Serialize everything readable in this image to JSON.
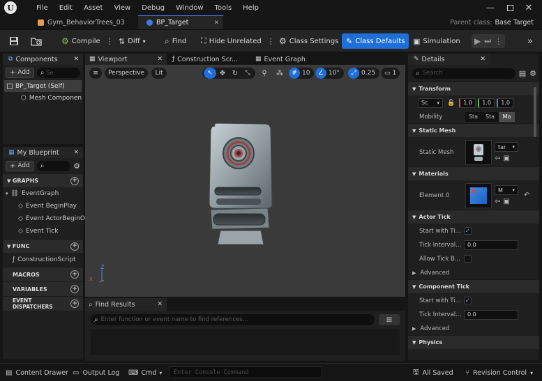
{
  "menu": [
    "File",
    "Edit",
    "Asset",
    "View",
    "Debug",
    "Window",
    "Tools",
    "Help"
  ],
  "doc_tabs": [
    {
      "label": "Gym_BehaviorTrees_03",
      "active": false
    },
    {
      "label": "BP_Target",
      "active": true
    }
  ],
  "parent_class": {
    "label": "Parent class:",
    "value": "Base Target"
  },
  "toolbar": {
    "compile": "Compile",
    "diff": "Diff",
    "find": "Find",
    "hide_unrelated": "Hide Unrelated",
    "class_settings": "Class Settings",
    "class_defaults": "Class Defaults",
    "simulation": "Simulation"
  },
  "components": {
    "tab": "Components",
    "add": "Add",
    "search_placeholder": "Se",
    "items": [
      "BP_Target (Self)",
      "Mesh Componen"
    ]
  },
  "blueprint": {
    "tab": "My Blueprint",
    "add": "Add",
    "graphs_header": "GRAPHS",
    "graph": "EventGraph",
    "events": [
      "Event BeginPlay",
      "Event ActorBeginO",
      "Event Tick"
    ],
    "func_header": "FUNC",
    "func_item": "ConstructionScript",
    "macros": "MACROS",
    "variables": "VARIABLES",
    "dispatchers": "EVENT DISPATCHERS"
  },
  "editor_tabs": [
    "Viewport",
    "Construction Scr...",
    "Event Graph"
  ],
  "viewport": {
    "perspective": "Perspective",
    "lit": "Lit",
    "grid_value": "10",
    "rot_value": "10°",
    "scale_value": "0.25",
    "cam_value": "1",
    "axis_z": "Z",
    "axis_x": "X"
  },
  "find_results": {
    "tab": "Find Results",
    "placeholder": "Enter function or event name to find references..."
  },
  "details": {
    "tab": "Details",
    "search_placeholder": "Search",
    "transform": {
      "header": "Transform",
      "dropdown": "Sc",
      "x": "1.0",
      "y": "1.0",
      "z": "1.0",
      "mobility_label": "Mobility",
      "mobility_options": [
        "Sta",
        "Sta",
        "Mo"
      ]
    },
    "static_mesh": {
      "header": "Static Mesh",
      "label": "Static Mesh",
      "value": "tar"
    },
    "materials": {
      "header": "Materials",
      "label": "Element 0",
      "value": "M"
    },
    "actor_tick": {
      "header": "Actor Tick",
      "start_label": "Start with Ti...",
      "interval_label": "Tick Interval...",
      "interval_value": "0.0",
      "allow_label": "Allow Tick B...",
      "advanced": "Advanced"
    },
    "component_tick": {
      "header": "Component Tick",
      "start_label": "Start with Ti...",
      "interval_label": "Tick Interval...",
      "interval_value": "0.0",
      "advanced": "Advanced"
    },
    "physics": {
      "header": "Physics"
    }
  },
  "statusbar": {
    "content_drawer": "Content Drawer",
    "output_log": "Output Log",
    "cmd": "Cmd",
    "console_placeholder": "Enter Console Command",
    "all_saved": "All Saved",
    "revision_control": "Revision Control"
  },
  "colors": {
    "accent": "#1f6fd9",
    "window_bg": "#151515",
    "panel_bg": "#1f1f1f",
    "viewport_bg": "#3a3a3a"
  }
}
